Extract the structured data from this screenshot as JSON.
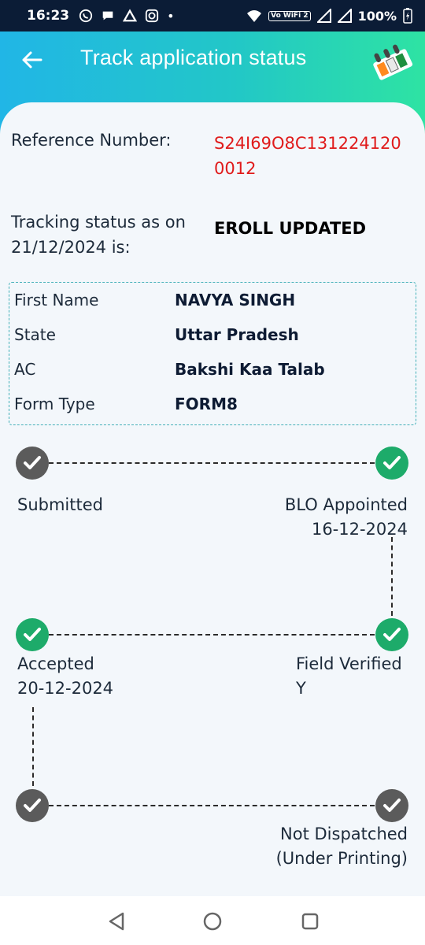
{
  "status_bar": {
    "time": "16:23",
    "battery": "100%",
    "wifi_badge": "Vo WiFi 2"
  },
  "header": {
    "title": "Track application status",
    "back_icon": "arrow-left-icon",
    "logo": "eci-logo"
  },
  "application": {
    "reference_label": "Reference Number:",
    "reference_value": "S24I69O8C131224120 0012",
    "tracking_label": "Tracking status as on 21/12/2024 is:",
    "tracking_value": "EROLL UPDATED"
  },
  "details": [
    {
      "label": "First Name",
      "value": "NAVYA SINGH"
    },
    {
      "label": "State",
      "value": "Uttar Pradesh"
    },
    {
      "label": "AC",
      "value": "Bakshi Kaa Talab"
    },
    {
      "label": "Form Type",
      "value": "FORM8"
    }
  ],
  "timeline": {
    "submitted": {
      "label": "Submitted",
      "status": "completed-gray"
    },
    "blo_appointed": {
      "label": "BLO Appointed",
      "date": "16-12-2024",
      "status": "completed-green"
    },
    "accepted": {
      "label": "Accepted",
      "date": "20-12-2024",
      "status": "completed-green"
    },
    "field_verified": {
      "label": "Field Verified",
      "value": "Y",
      "status": "completed-green"
    },
    "node_5": {
      "status": "completed-gray"
    },
    "not_dispatched": {
      "label_line1": "Not Dispatched",
      "label_line2": "(Under Printing)",
      "status": "completed-gray"
    }
  },
  "colors": {
    "header_start": "#21b6e6",
    "header_end": "#2ee3a3",
    "reference": "#e01b1b",
    "green_node": "#1dab6a",
    "gray_node": "#5b5b5b",
    "border": "#43b0b8"
  },
  "nav": {
    "back": "back-triangle-icon",
    "home": "home-circle-icon",
    "recents": "recents-square-icon"
  }
}
